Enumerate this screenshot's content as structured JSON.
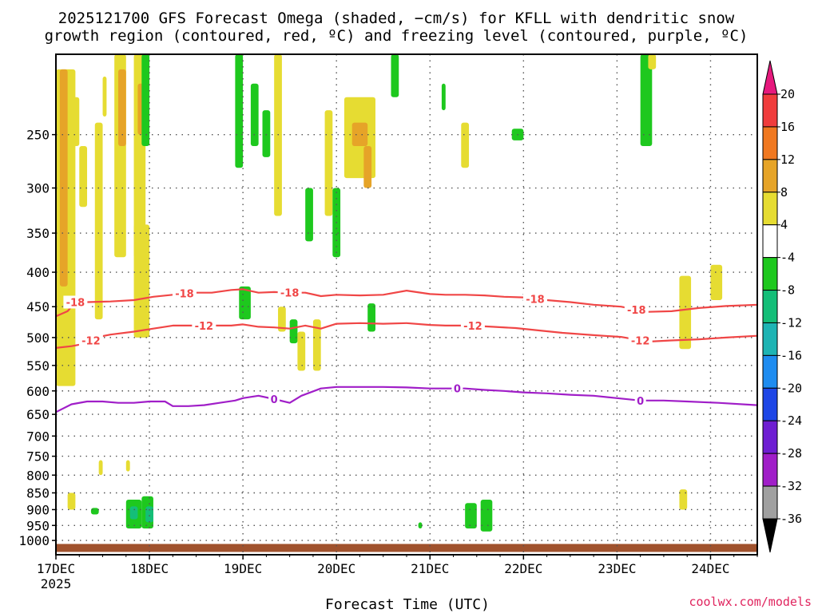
{
  "chart_data": {
    "type": "heatmap",
    "title_line1": "2025121700 GFS Forecast Omega (shaded, −cm/s) for KFLL with dendritic snow",
    "title_line2": "growth region (contoured, red, ºC) and freezing level (contoured, purple, ºC)",
    "xlabel": "Forecast Time (UTC)",
    "credit": "coolwx.com/models",
    "x_range_hours": [
      0,
      180
    ],
    "x_ticks": [
      {
        "hour": 0,
        "label": "17DEC",
        "sublabel": "2025"
      },
      {
        "hour": 24,
        "label": "18DEC"
      },
      {
        "hour": 48,
        "label": "19DEC"
      },
      {
        "hour": 72,
        "label": "20DEC"
      },
      {
        "hour": 96,
        "label": "21DEC"
      },
      {
        "hour": 120,
        "label": "22DEC"
      },
      {
        "hour": 144,
        "label": "23DEC"
      },
      {
        "hour": 168,
        "label": "24DEC"
      }
    ],
    "y_scale": "log-pressure (hPa), inverted",
    "y_range_hpa": [
      1050,
      190
    ],
    "y_ticks": [
      250,
      300,
      350,
      400,
      450,
      500,
      550,
      600,
      650,
      700,
      750,
      800,
      850,
      900,
      950,
      1000
    ],
    "grid": true,
    "colorbar": {
      "ticks": [
        20,
        16,
        12,
        8,
        4,
        -4,
        -8,
        -12,
        -16,
        -20,
        -24,
        -28,
        -32,
        -36
      ],
      "bins": [
        {
          "from": 16,
          "to": 20,
          "color": "#f03c3c"
        },
        {
          "from": 12,
          "to": 16,
          "color": "#f07820"
        },
        {
          "from": 8,
          "to": 12,
          "color": "#e6a428"
        },
        {
          "from": 4,
          "to": 8,
          "color": "#e6dc32"
        },
        {
          "from": -4,
          "to": 4,
          "color": "#ffffff"
        },
        {
          "from": -8,
          "to": -4,
          "color": "#1ec81e"
        },
        {
          "from": -12,
          "to": -8,
          "color": "#14be78"
        },
        {
          "from": -16,
          "to": -12,
          "color": "#1eb4b4"
        },
        {
          "from": -20,
          "to": -16,
          "color": "#1e8cf0"
        },
        {
          "from": -24,
          "to": -20,
          "color": "#1e46e6"
        },
        {
          "from": -28,
          "to": -24,
          "color": "#6e1ed2"
        },
        {
          "from": -32,
          "to": -28,
          "color": "#a01ec8"
        },
        {
          "from": -36,
          "to": -32,
          "color": "#a0a0a0"
        }
      ],
      "top_color": "#e6197d",
      "bottom_color": "#000000"
    },
    "contours": [
      {
        "label": "-18",
        "color": "#f04646",
        "label_hours": [
          5,
          33,
          60,
          123,
          149
        ],
        "points": [
          [
            0,
            465
          ],
          [
            3,
            457
          ],
          [
            5,
            443
          ],
          [
            8,
            443
          ],
          [
            14,
            442
          ],
          [
            20,
            440
          ],
          [
            25,
            435
          ],
          [
            30,
            432
          ],
          [
            35,
            429
          ],
          [
            40,
            429
          ],
          [
            45,
            425
          ],
          [
            48,
            424
          ],
          [
            52,
            429
          ],
          [
            56,
            428
          ],
          [
            60,
            429
          ],
          [
            64,
            429
          ],
          [
            68,
            434
          ],
          [
            72,
            432
          ],
          [
            78,
            433
          ],
          [
            84,
            432
          ],
          [
            90,
            426
          ],
          [
            96,
            431
          ],
          [
            100,
            432
          ],
          [
            105,
            432
          ],
          [
            110,
            433
          ],
          [
            115,
            435
          ],
          [
            120,
            436
          ],
          [
            126,
            440
          ],
          [
            132,
            443
          ],
          [
            138,
            447
          ],
          [
            145,
            450
          ],
          [
            152,
            458
          ],
          [
            158,
            457
          ],
          [
            165,
            452
          ],
          [
            172,
            449
          ],
          [
            180,
            447
          ]
        ]
      },
      {
        "label": "-12",
        "color": "#f04646",
        "label_hours": [
          9,
          38,
          107,
          150
        ],
        "points": [
          [
            0,
            518
          ],
          [
            4,
            515
          ],
          [
            8,
            510
          ],
          [
            10,
            500
          ],
          [
            14,
            495
          ],
          [
            20,
            490
          ],
          [
            25,
            485
          ],
          [
            30,
            480
          ],
          [
            35,
            480
          ],
          [
            40,
            480
          ],
          [
            45,
            480
          ],
          [
            48,
            478
          ],
          [
            52,
            482
          ],
          [
            56,
            483
          ],
          [
            60,
            485
          ],
          [
            64,
            480
          ],
          [
            68,
            485
          ],
          [
            72,
            477
          ],
          [
            78,
            476
          ],
          [
            84,
            477
          ],
          [
            90,
            476
          ],
          [
            96,
            479
          ],
          [
            100,
            480
          ],
          [
            106,
            480
          ],
          [
            112,
            482
          ],
          [
            118,
            484
          ],
          [
            124,
            488
          ],
          [
            130,
            492
          ],
          [
            138,
            496
          ],
          [
            145,
            499
          ],
          [
            152,
            507
          ],
          [
            158,
            505
          ],
          [
            165,
            503
          ],
          [
            172,
            500
          ],
          [
            180,
            497
          ]
        ]
      },
      {
        "label": "0",
        "color": "#a01ec8",
        "label_hours": [
          56,
          103,
          150
        ],
        "points": [
          [
            0,
            645
          ],
          [
            4,
            628
          ],
          [
            8,
            622
          ],
          [
            12,
            622
          ],
          [
            16,
            625
          ],
          [
            20,
            625
          ],
          [
            24,
            622
          ],
          [
            28,
            622
          ],
          [
            30,
            632
          ],
          [
            34,
            632
          ],
          [
            38,
            630
          ],
          [
            42,
            625
          ],
          [
            46,
            620
          ],
          [
            48,
            615
          ],
          [
            52,
            610
          ],
          [
            56,
            617
          ],
          [
            60,
            625
          ],
          [
            63,
            610
          ],
          [
            68,
            595
          ],
          [
            72,
            592
          ],
          [
            78,
            592
          ],
          [
            84,
            592
          ],
          [
            90,
            593
          ],
          [
            96,
            595
          ],
          [
            100,
            595
          ],
          [
            105,
            595
          ],
          [
            110,
            598
          ],
          [
            115,
            600
          ],
          [
            120,
            603
          ],
          [
            126,
            605
          ],
          [
            132,
            608
          ],
          [
            138,
            610
          ],
          [
            144,
            615
          ],
          [
            150,
            620
          ],
          [
            156,
            620
          ],
          [
            162,
            622
          ],
          [
            170,
            625
          ],
          [
            180,
            630
          ]
        ]
      }
    ],
    "shaded_regions": [
      {
        "hours": [
          0,
          5
        ],
        "p_hpa": [
          200,
          590
        ],
        "value": 6
      },
      {
        "hours": [
          1,
          3
        ],
        "p_hpa": [
          200,
          420
        ],
        "value": 10
      },
      {
        "hours": [
          4,
          6
        ],
        "p_hpa": [
          220,
          260
        ],
        "value": 6
      },
      {
        "hours": [
          6,
          8
        ],
        "p_hpa": [
          260,
          320
        ],
        "value": 6
      },
      {
        "hours": [
          10,
          12
        ],
        "p_hpa": [
          240,
          470
        ],
        "value": 6
      },
      {
        "hours": [
          12,
          13
        ],
        "p_hpa": [
          205,
          235
        ],
        "value": 6
      },
      {
        "hours": [
          15,
          18
        ],
        "p_hpa": [
          190,
          380
        ],
        "value": 6
      },
      {
        "hours": [
          16,
          18
        ],
        "p_hpa": [
          200,
          260
        ],
        "value": 10
      },
      {
        "hours": [
          20,
          23
        ],
        "p_hpa": [
          190,
          380
        ],
        "value": 6
      },
      {
        "hours": [
          21,
          23
        ],
        "p_hpa": [
          210,
          250
        ],
        "value": 10
      },
      {
        "hours": [
          22,
          24
        ],
        "p_hpa": [
          190,
          260
        ],
        "value": -6
      },
      {
        "hours": [
          20,
          24
        ],
        "p_hpa": [
          340,
          500
        ],
        "value": 6
      },
      {
        "hours": [
          46,
          48
        ],
        "p_hpa": [
          190,
          280
        ],
        "value": -6
      },
      {
        "hours": [
          47,
          50
        ],
        "p_hpa": [
          420,
          470
        ],
        "value": -6
      },
      {
        "hours": [
          50,
          52
        ],
        "p_hpa": [
          210,
          260
        ],
        "value": -6
      },
      {
        "hours": [
          53,
          55
        ],
        "p_hpa": [
          230,
          270
        ],
        "value": -6
      },
      {
        "hours": [
          56,
          58
        ],
        "p_hpa": [
          190,
          330
        ],
        "value": 6
      },
      {
        "hours": [
          57,
          59
        ],
        "p_hpa": [
          450,
          490
        ],
        "value": 6
      },
      {
        "hours": [
          60,
          62
        ],
        "p_hpa": [
          470,
          510
        ],
        "value": -6
      },
      {
        "hours": [
          62,
          64
        ],
        "p_hpa": [
          490,
          560
        ],
        "value": 6
      },
      {
        "hours": [
          64,
          66
        ],
        "p_hpa": [
          300,
          360
        ],
        "value": -6
      },
      {
        "hours": [
          66,
          68
        ],
        "p_hpa": [
          470,
          560
        ],
        "value": 6
      },
      {
        "hours": [
          69,
          71
        ],
        "p_hpa": [
          230,
          330
        ],
        "value": 6
      },
      {
        "hours": [
          71,
          73
        ],
        "p_hpa": [
          300,
          380
        ],
        "value": -6
      },
      {
        "hours": [
          74,
          82
        ],
        "p_hpa": [
          220,
          290
        ],
        "value": 6
      },
      {
        "hours": [
          76,
          80
        ],
        "p_hpa": [
          240,
          260
        ],
        "value": 10
      },
      {
        "hours": [
          79,
          81
        ],
        "p_hpa": [
          260,
          300
        ],
        "value": 10
      },
      {
        "hours": [
          86,
          88
        ],
        "p_hpa": [
          190,
          220
        ],
        "value": -6
      },
      {
        "hours": [
          80,
          82
        ],
        "p_hpa": [
          445,
          490
        ],
        "value": -6
      },
      {
        "hours": [
          99,
          100
        ],
        "p_hpa": [
          210,
          230
        ],
        "value": -6
      },
      {
        "hours": [
          104,
          106
        ],
        "p_hpa": [
          240,
          280
        ],
        "value": 6
      },
      {
        "hours": [
          117,
          120
        ],
        "p_hpa": [
          245,
          255
        ],
        "value": -6
      },
      {
        "hours": [
          150,
          153
        ],
        "p_hpa": [
          190,
          260
        ],
        "value": -6
      },
      {
        "hours": [
          152,
          154
        ],
        "p_hpa": [
          190,
          200
        ],
        "value": 6
      },
      {
        "hours": [
          160,
          163
        ],
        "p_hpa": [
          405,
          520
        ],
        "value": 6
      },
      {
        "hours": [
          168,
          171
        ],
        "p_hpa": [
          390,
          440
        ],
        "value": 6
      },
      {
        "hours": [
          3,
          5
        ],
        "p_hpa": [
          850,
          900
        ],
        "value": 6
      },
      {
        "hours": [
          9,
          11
        ],
        "p_hpa": [
          895,
          915
        ],
        "value": -6
      },
      {
        "hours": [
          18,
          22
        ],
        "p_hpa": [
          870,
          960
        ],
        "value": -6
      },
      {
        "hours": [
          19,
          21
        ],
        "p_hpa": [
          890,
          930
        ],
        "value": -10
      },
      {
        "hours": [
          22,
          25
        ],
        "p_hpa": [
          860,
          960
        ],
        "value": -6
      },
      {
        "hours": [
          23,
          25
        ],
        "p_hpa": [
          890,
          940
        ],
        "value": -10
      },
      {
        "hours": [
          18,
          19
        ],
        "p_hpa": [
          760,
          790
        ],
        "value": 6
      },
      {
        "hours": [
          11,
          12
        ],
        "p_hpa": [
          760,
          800
        ],
        "value": 6
      },
      {
        "hours": [
          93,
          94
        ],
        "p_hpa": [
          940,
          960
        ],
        "value": -6
      },
      {
        "hours": [
          105,
          108
        ],
        "p_hpa": [
          880,
          960
        ],
        "value": -6
      },
      {
        "hours": [
          109,
          112
        ],
        "p_hpa": [
          870,
          970
        ],
        "value": -6
      },
      {
        "hours": [
          160,
          162
        ],
        "p_hpa": [
          840,
          900
        ],
        "value": 6
      }
    ],
    "terrain_band_hpa": [
      1012,
      1040
    ],
    "terrain_color": "#a0522d"
  }
}
